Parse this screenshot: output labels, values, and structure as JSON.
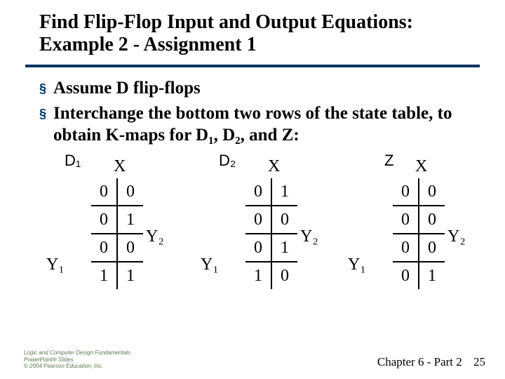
{
  "title": "Find Flip-Flop Input and Output Equations: Example 2 - Assignment 1",
  "bullets": [
    "Assume D flip-flops",
    "Interchange the bottom two rows of the state table, to obtain K-maps for D₁, D₂, and Z:"
  ],
  "axis": {
    "x": "X",
    "y1": "Y₁",
    "y2": "Y₂"
  },
  "maps": [
    {
      "label": "D₁",
      "grid": [
        [
          "0",
          "0"
        ],
        [
          "0",
          "1"
        ],
        [
          "0",
          "0"
        ],
        [
          "1",
          "1"
        ]
      ]
    },
    {
      "label": "D₂",
      "grid": [
        [
          "0",
          "1"
        ],
        [
          "0",
          "0"
        ],
        [
          "0",
          "1"
        ],
        [
          "1",
          "0"
        ]
      ]
    },
    {
      "label": "Z",
      "grid": [
        [
          "0",
          "0"
        ],
        [
          "0",
          "0"
        ],
        [
          "0",
          "0"
        ],
        [
          "0",
          "1"
        ]
      ]
    }
  ],
  "footer": {
    "credit_l1": "Logic and Computer Design Fundamentals",
    "credit_l2": "PowerPoint® Slides",
    "credit_l3": "© 2004 Pearson Education, Inc.",
    "chapter": "Chapter 6 - Part 2",
    "page": "25"
  }
}
